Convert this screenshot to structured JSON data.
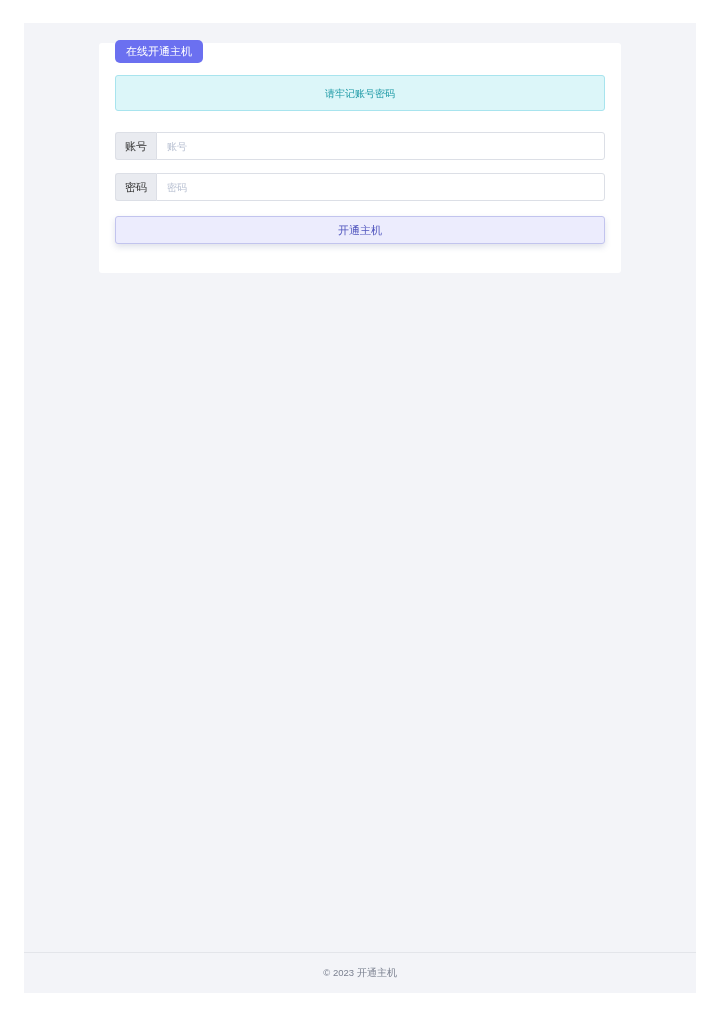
{
  "card": {
    "badge": "在线开通主机",
    "alert": "请牢记账号密码",
    "fields": [
      {
        "label": "账号",
        "placeholder": "账号"
      },
      {
        "label": "密码",
        "placeholder": "密码"
      }
    ],
    "submit": "开通主机"
  },
  "footer": {
    "text": "© 2023 开通主机"
  }
}
